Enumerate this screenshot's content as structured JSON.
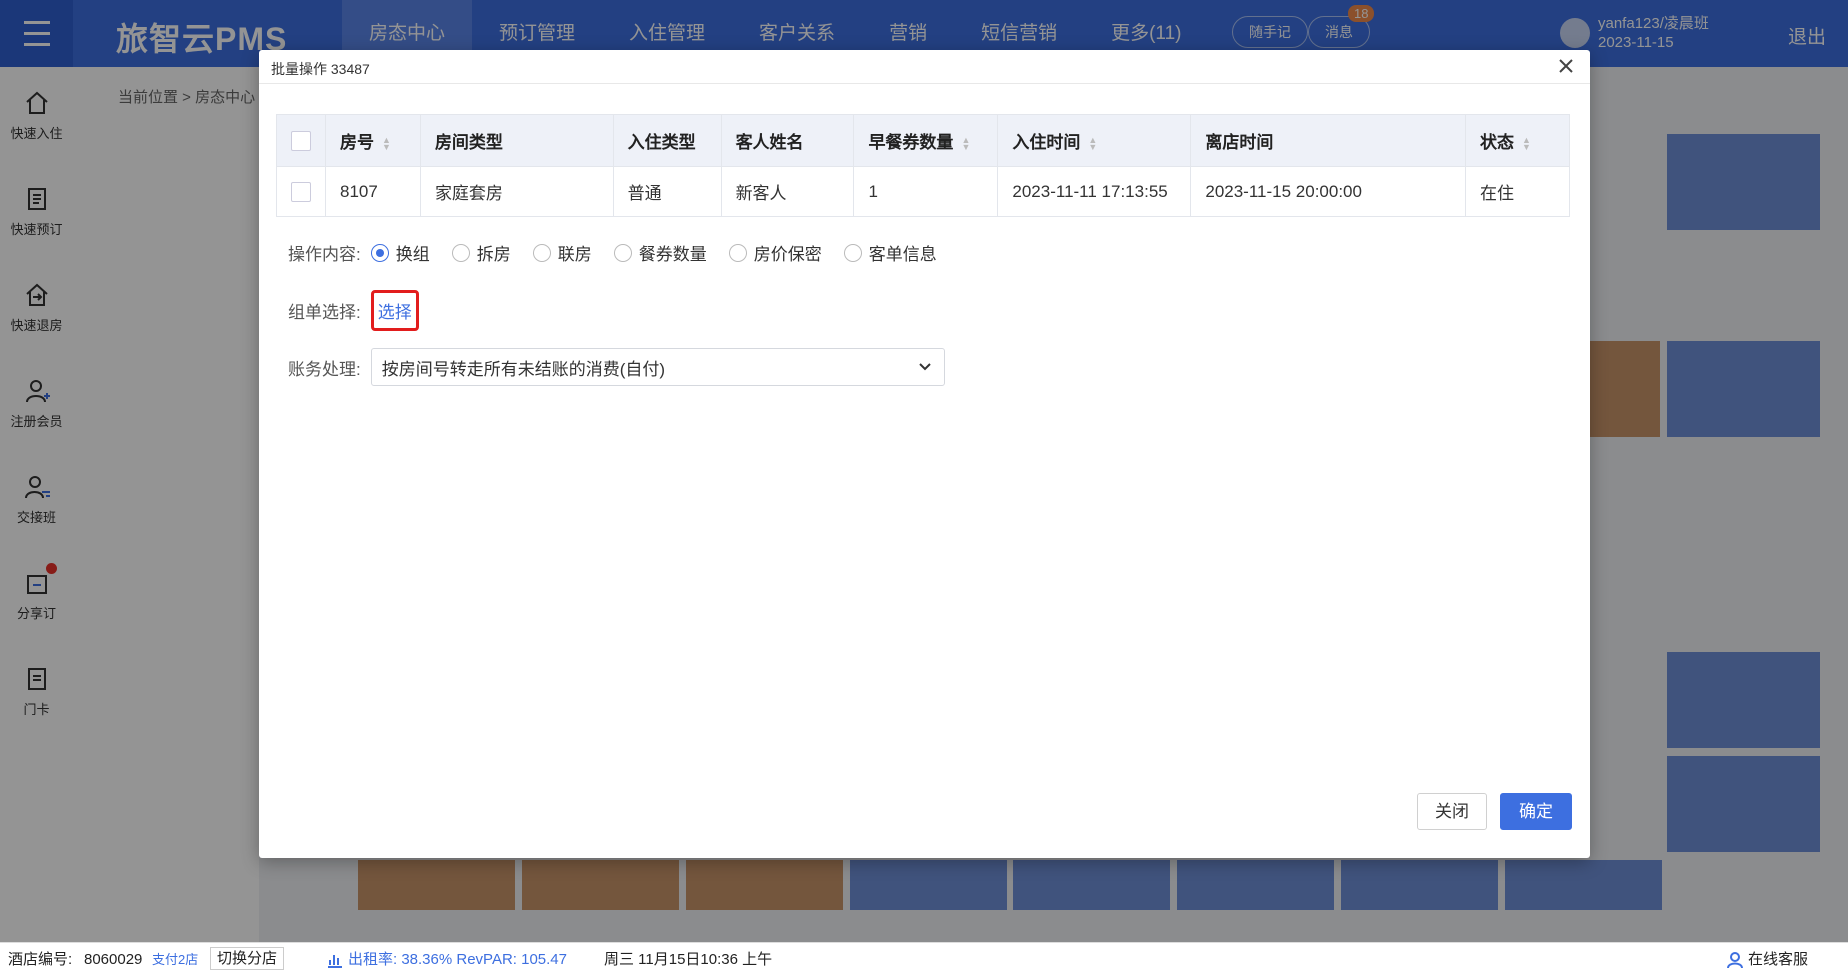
{
  "app": {
    "brand": "旅智云PMS",
    "nav": [
      "房态中心",
      "预订管理",
      "入住管理",
      "客户关系",
      "营销",
      "短信营销",
      "更多(11)"
    ],
    "pill_note": "随手记",
    "pill_msg": "消息",
    "msg_count": "18",
    "user_line1": "yanfa123/凌晨班",
    "user_line2": "2023-11-15",
    "logout": "退出",
    "breadcrumb": "当前位置 > 房态中心",
    "sidebar": [
      "快速入住",
      "快速预订",
      "快速退房",
      "注册会员",
      "交接班",
      "分享订",
      "门卡"
    ]
  },
  "status_bar": {
    "hotel_label": "酒店编号:",
    "hotel_id": "8060029",
    "branch": "支付2店",
    "switch": "切换分店",
    "occupancy": "出租率: 38.36% RevPAR: 105.47",
    "datetime": "周三 11月15日10:36 上午",
    "service": "在线客服"
  },
  "modal": {
    "title": "批量操作 33487",
    "columns": [
      "房号",
      "房间类型",
      "入住类型",
      "客人姓名",
      "早餐券数量",
      "入住时间",
      "离店时间",
      "状态"
    ],
    "row": {
      "room_no": "8107",
      "room_type": "家庭套房",
      "checkin_type": "普通",
      "guest": "新客人",
      "breakfast": "1",
      "checkin_time": "2023-11-11 17:13:55",
      "checkout_time": "2023-11-15 20:00:00",
      "status": "在住"
    },
    "op_label": "操作内容:",
    "options": [
      "换组",
      "拆房",
      "联房",
      "餐券数量",
      "房价保密",
      "客单信息"
    ],
    "selected_option": "换组",
    "group_label": "组单选择:",
    "group_link": "选择",
    "account_label": "账务处理:",
    "account_value": "按房间号转走所有未结账的消费(自付)",
    "btn_close": "关闭",
    "btn_ok": "确定"
  },
  "colors": {
    "primary": "#3d6fe0",
    "highlight_border": "#e21d1d"
  }
}
